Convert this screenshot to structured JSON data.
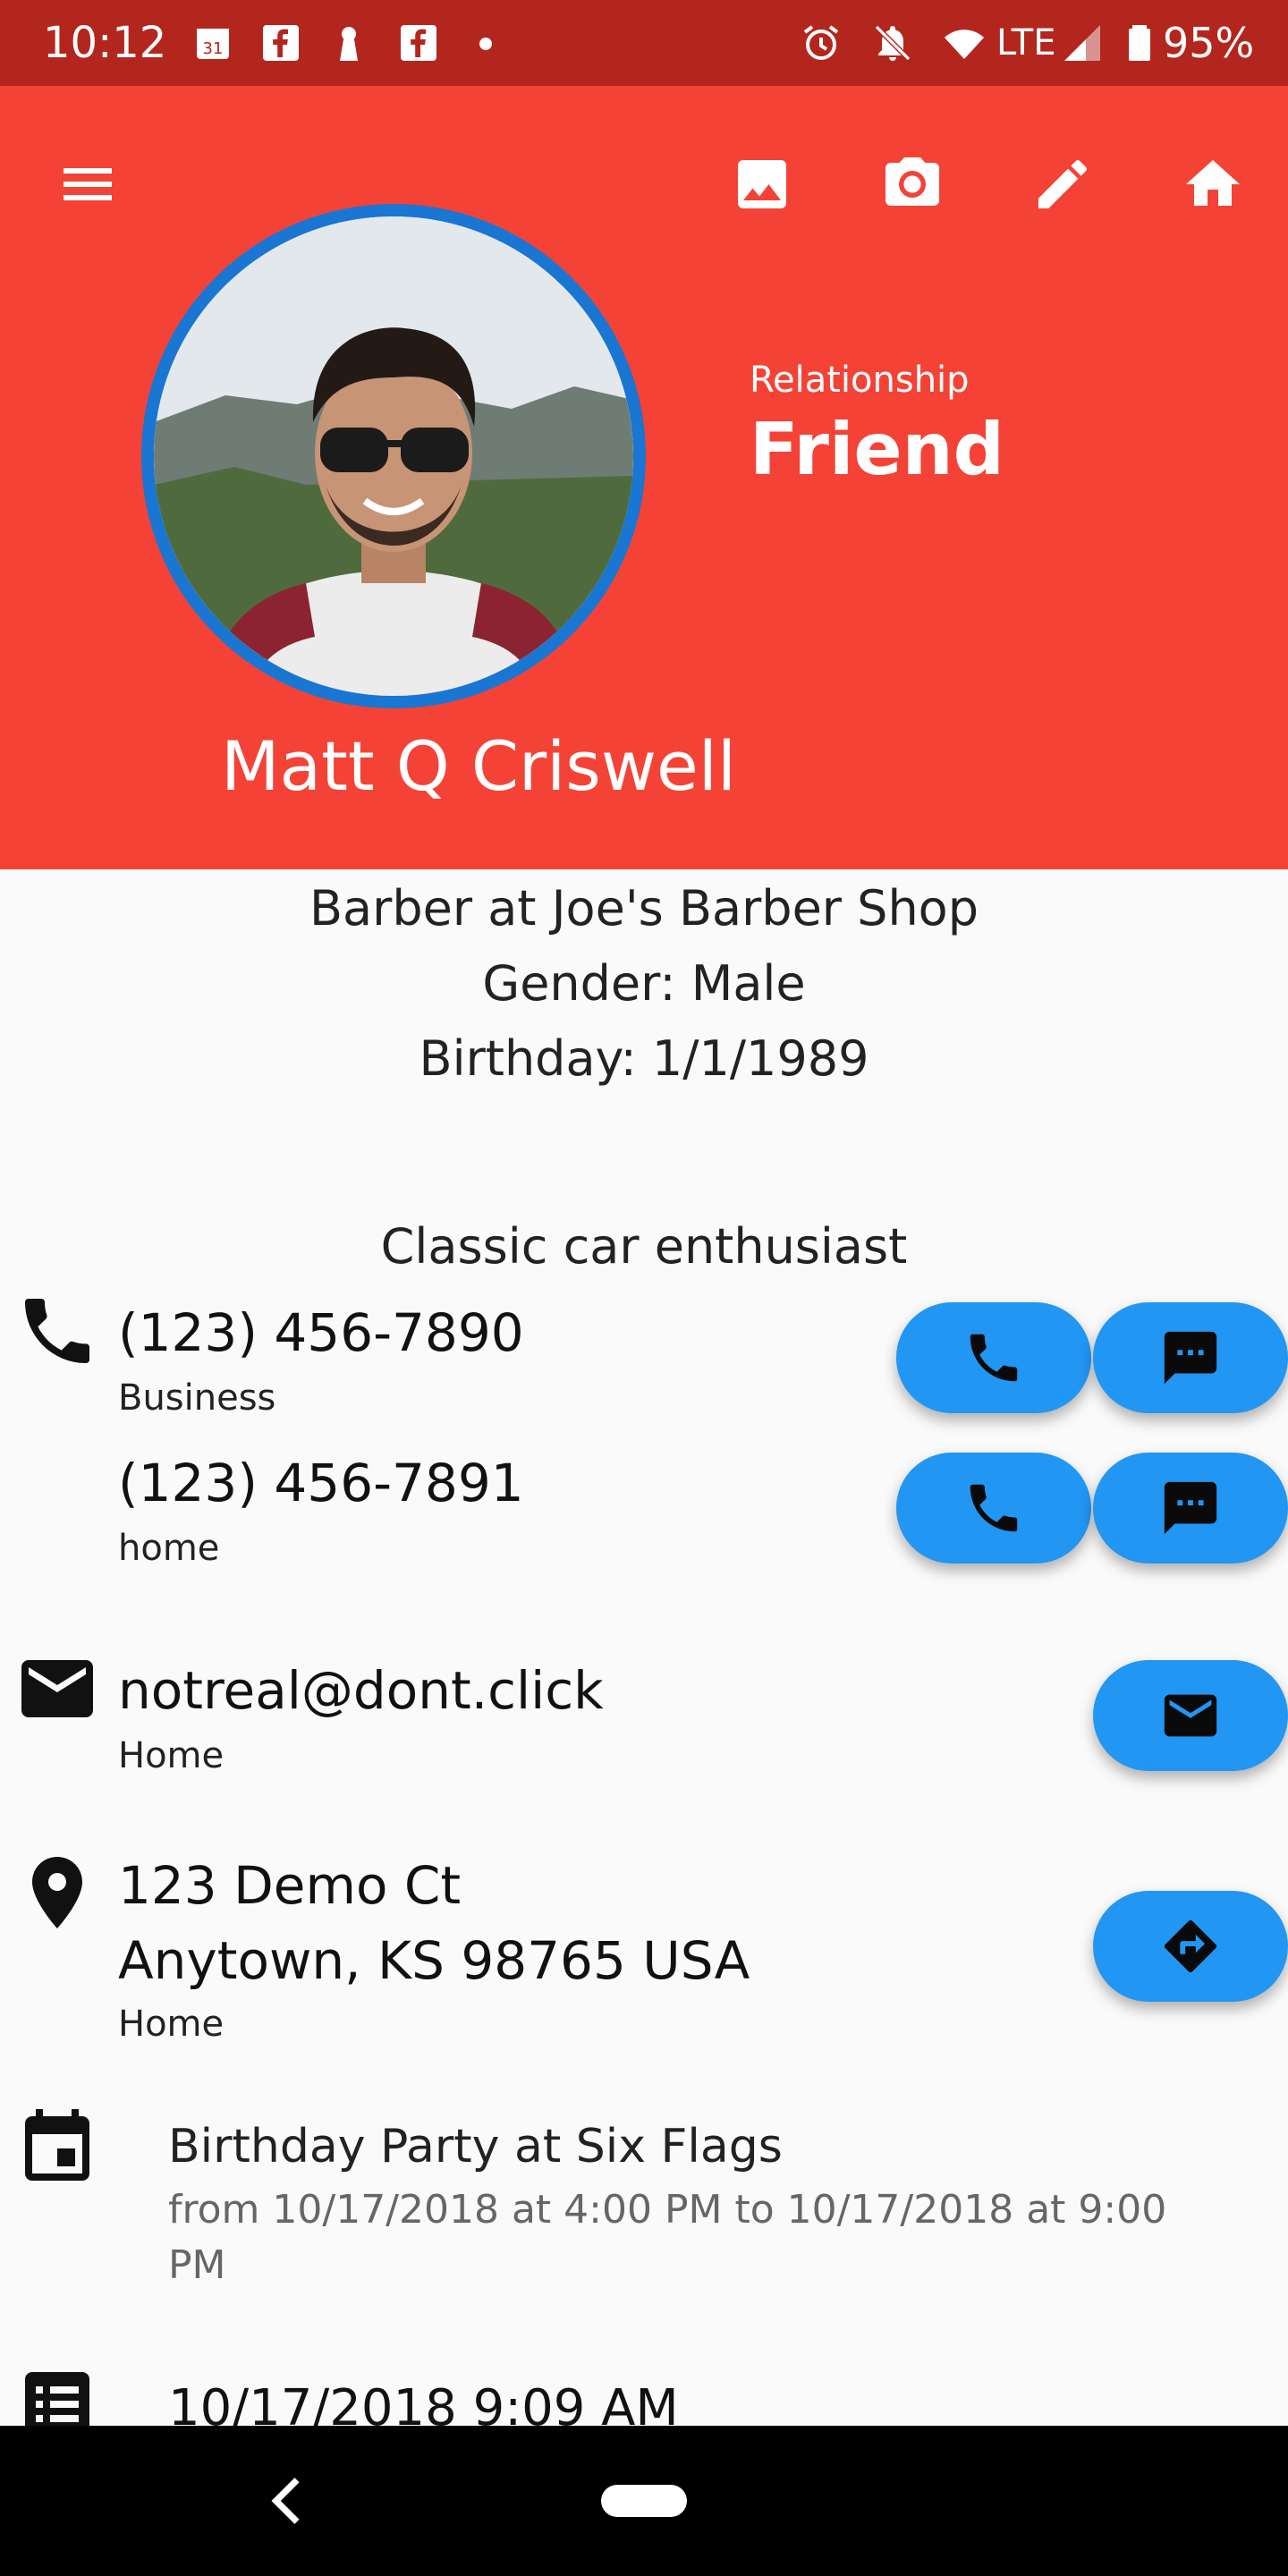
{
  "status_bar": {
    "time": "10:12",
    "calendar_day": "31",
    "network": "LTE",
    "battery": "95%"
  },
  "toolbar": {
    "icons": [
      "menu-icon",
      "image-icon",
      "camera-icon",
      "edit-icon",
      "home-icon"
    ]
  },
  "profile": {
    "relationship_label": "Relationship",
    "relationship_value": "Friend",
    "name": "Matt Q Criswell"
  },
  "summary": {
    "job": "Barber at Joe's Barber Shop",
    "gender": "Gender: Male",
    "birthday": "Birthday:  1/1/1989",
    "bio": "Classic car enthusiast"
  },
  "phones": [
    {
      "number": "(123) 456-7890",
      "type": "Business"
    },
    {
      "number": "(123) 456-7891",
      "type": "home"
    }
  ],
  "email": {
    "address": "notreal@dont.click",
    "type": "Home"
  },
  "address": {
    "line1": "123 Demo Ct",
    "line2": "Anytown, KS 98765 USA",
    "type": "Home"
  },
  "event": {
    "title": "Birthday Party at Six Flags",
    "detail": "from 10/17/2018 at 4:00 PM to 10/17/2018 at 9:00 PM"
  },
  "note": {
    "timestamp": "10/17/2018 9:09 AM"
  },
  "colors": {
    "header": "#f44336",
    "status_bar": "#b3261e",
    "avatar_ring": "#1976d2",
    "fab": "#2196f3"
  }
}
